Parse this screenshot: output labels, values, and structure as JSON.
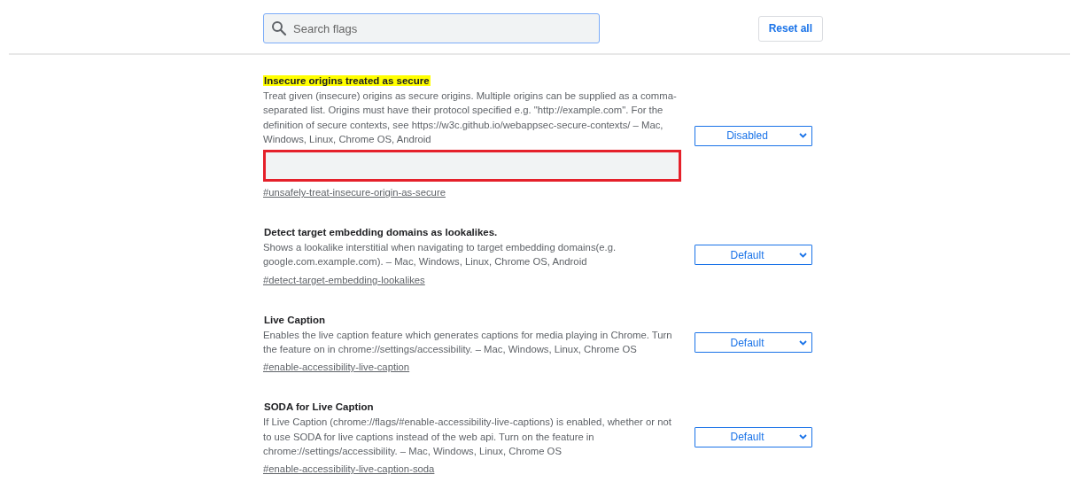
{
  "search": {
    "placeholder": "Search flags"
  },
  "reset_button": "Reset all",
  "flags": [
    {
      "title": "Insecure origins treated as secure",
      "highlighted": true,
      "description": "Treat given (insecure) origins as secure origins. Multiple origins can be supplied as a comma-separated list. Origins must have their protocol specified e.g. \"http://example.com\". For the definition of secure contexts, see https://w3c.github.io/webappsec-secure-contexts/ – Mac, Windows, Linux, Chrome OS, Android",
      "kind": "textarea",
      "field_outlined": true,
      "link": "#unsafely-treat-insecure-origin-as-secure",
      "value": "Disabled"
    },
    {
      "title": "Detect target embedding domains as lookalikes.",
      "highlighted": false,
      "description": "Shows a lookalike interstitial when navigating to target embedding domains(e.g. google.com.example.com). – Mac, Windows, Linux, Chrome OS, Android",
      "kind": "plain",
      "link": "#detect-target-embedding-lookalikes",
      "value": "Default"
    },
    {
      "title": "Live Caption",
      "highlighted": false,
      "description": "Enables the live caption feature which generates captions for media playing in Chrome. Turn the feature on in chrome://settings/accessibility. – Mac, Windows, Linux, Chrome OS",
      "kind": "plain",
      "link": "#enable-accessibility-live-caption",
      "value": "Default"
    },
    {
      "title": "SODA for Live Caption",
      "highlighted": false,
      "description": "If Live Caption (chrome://flags/#enable-accessibility-live-captions) is enabled, whether or not to use SODA for live captions instead of the web api. Turn on the feature in chrome://settings/accessibility. – Mac, Windows, Linux, Chrome OS",
      "kind": "plain",
      "link": "#enable-accessibility-live-caption-soda",
      "value": "Default"
    }
  ]
}
